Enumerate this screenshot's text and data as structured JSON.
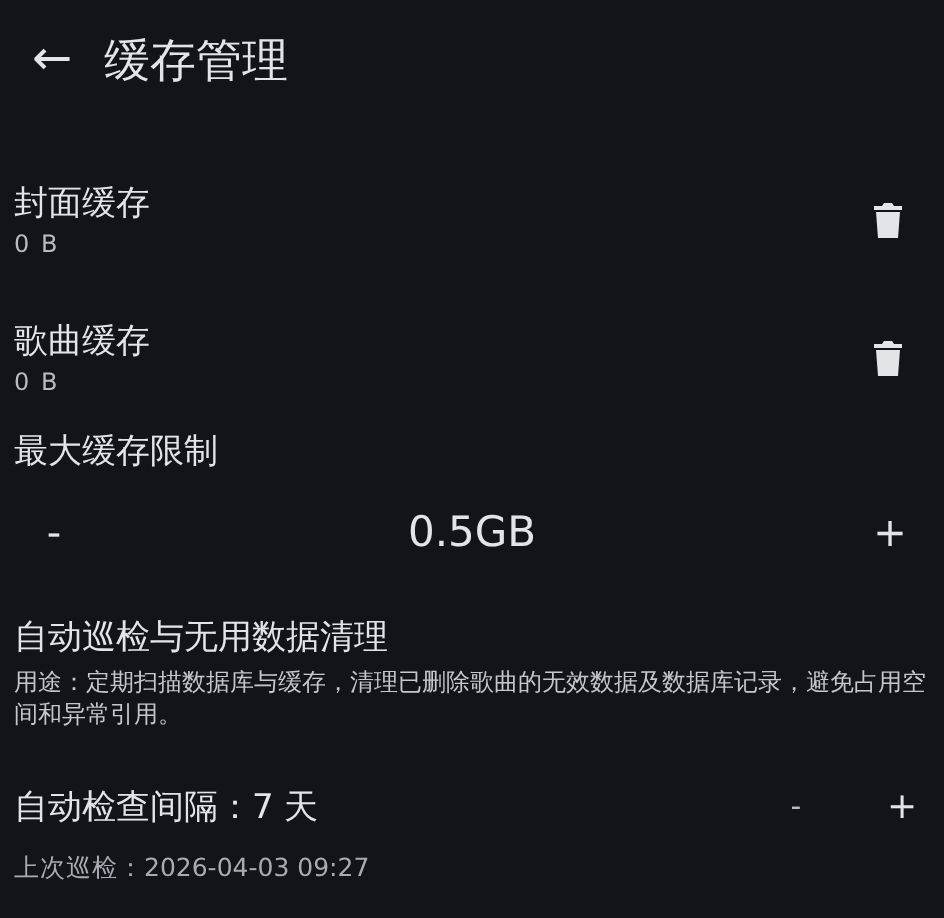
{
  "app_bar": {
    "back_icon": "←",
    "title": "缓存管理"
  },
  "caches": [
    {
      "name": "封面缓存",
      "size": "0 B"
    },
    {
      "name": "歌曲缓存",
      "size": "0 B"
    }
  ],
  "max_cache": {
    "label": "最大缓存限制",
    "decrement": "-",
    "value": "0.5GB",
    "increment": "+"
  },
  "auto_check": {
    "title": "自动巡检与无用数据清理",
    "description": "用途：定期扫描数据库与缓存，清理已删除歌曲的无效数据及数据库记录，避免占用空间和异常引用。",
    "interval": "自动检查间隔：7 天",
    "decrement": "-",
    "increment": "+",
    "last_check": "上次巡检：2026-04-03 09:27"
  }
}
